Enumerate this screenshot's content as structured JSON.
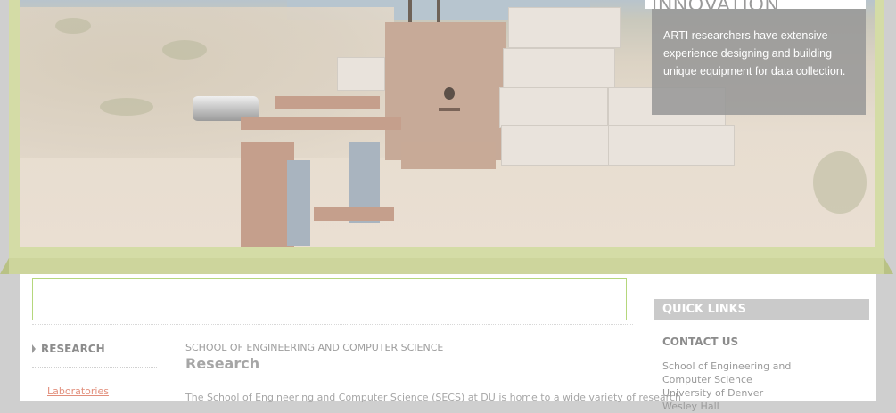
{
  "hero": {
    "panel_title": "INNOVATION",
    "panel_text": "ARTI researchers have extensive experience designing and building unique equipment for data collection."
  },
  "side_nav": {
    "heading": "RESEARCH",
    "items": [
      {
        "label": "Laboratories"
      }
    ]
  },
  "main": {
    "eyebrow": "SCHOOL OF ENGINEERING AND COMPUTER SCIENCE",
    "title": "Research",
    "intro": "The School of Engineering and Computer Science (SECS) at DU is home to a wide variety of research"
  },
  "quick_links": {
    "heading": "QUICK LINKS",
    "contact_heading": "CONTACT US",
    "address_lines": [
      "School of Engineering and",
      "Computer Science",
      "University of Denver",
      "Wesley Hall"
    ]
  },
  "colors": {
    "frame_green": "#d4dca6",
    "link_salmon": "#e28f7c",
    "banner_border": "#b5d77c"
  }
}
